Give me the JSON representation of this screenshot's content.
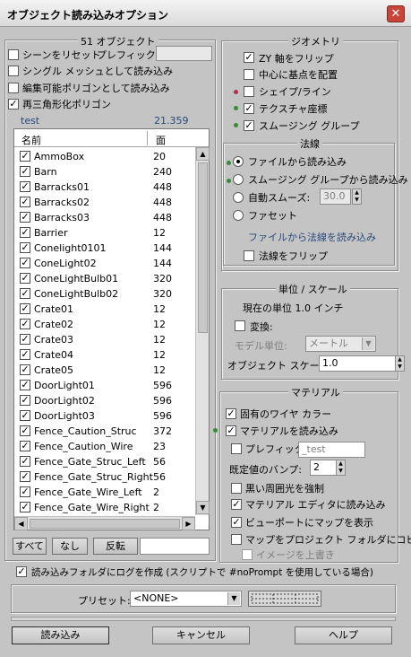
{
  "window": {
    "title": "オブジェクト読み込みオプション"
  },
  "left": {
    "object_count_label": "51 オブジェクト",
    "reset_scene": "シーンをリセット",
    "prefix_label": "プレフィックス:",
    "prefix_value": "",
    "single_mesh": "シングル メッシュとして読み込み",
    "editable_poly": "編集可能ポリゴンとして読み込み",
    "retriangulate": "再三角形化ポリゴン",
    "stat_name": "test",
    "stat_value": "21.359",
    "col_name": "名前",
    "col_faces": "面",
    "rows": [
      {
        "name": "AmmoBox",
        "faces": "20"
      },
      {
        "name": "Barn",
        "faces": "240"
      },
      {
        "name": "Barracks01",
        "faces": "448"
      },
      {
        "name": "Barracks02",
        "faces": "448"
      },
      {
        "name": "Barracks03",
        "faces": "448"
      },
      {
        "name": "Barrier",
        "faces": "12"
      },
      {
        "name": "Conelight0101",
        "faces": "144"
      },
      {
        "name": "ConeLight02",
        "faces": "144"
      },
      {
        "name": "ConeLightBulb01",
        "faces": "320"
      },
      {
        "name": "ConeLightBulb02",
        "faces": "320"
      },
      {
        "name": "Crate01",
        "faces": "12"
      },
      {
        "name": "Crate02",
        "faces": "12"
      },
      {
        "name": "Crate03",
        "faces": "12"
      },
      {
        "name": "Crate04",
        "faces": "12"
      },
      {
        "name": "Crate05",
        "faces": "12"
      },
      {
        "name": "DoorLight01",
        "faces": "596"
      },
      {
        "name": "DoorLight02",
        "faces": "596"
      },
      {
        "name": "DoorLight03",
        "faces": "596"
      },
      {
        "name": "Fence_Caution_Struc",
        "faces": "372"
      },
      {
        "name": "Fence_Caution_Wire",
        "faces": "23"
      },
      {
        "name": "Fence_Gate_Struc_Left",
        "faces": "56"
      },
      {
        "name": "Fence_Gate_Struc_Right",
        "faces": "56"
      },
      {
        "name": "Fence_Gate_Wire_Left",
        "faces": "2"
      },
      {
        "name": "Fence_Gate_Wire_Right",
        "faces": "2"
      }
    ],
    "btn_all": "すべて",
    "btn_none": "なし",
    "btn_invert": "反転"
  },
  "geometry": {
    "title": "ジオメトリ",
    "flip_zy": "ZY 軸をフリップ",
    "center_pivot": "中心に基点を配置",
    "shapes_lines": "シェイプ/ライン",
    "tex_coords": "テクスチャ座標",
    "smoothing_groups": "スムージング グループ"
  },
  "normals": {
    "title": "法線",
    "from_file": "ファイルから読み込み",
    "from_smoothing": "スムージング グループから読み込み",
    "auto_smooth": "自動スムーズ:",
    "auto_smooth_value": "30.0",
    "faceted": "ファセット",
    "note": "ファイルから法線を読み込み",
    "flip": "法線をフリップ"
  },
  "units": {
    "title": "単位 / スケール",
    "current": "現在の単位 1.0 インチ",
    "convert": "変換:",
    "model_units_label": "モデル単位:",
    "model_units_value": "メートル",
    "object_scale_label": "オブジェクト スケール:",
    "object_scale_value": "1.0"
  },
  "material": {
    "title": "マテリアル",
    "unique_wire": "固有のワイヤ カラー",
    "import_materials": "マテリアルを読み込み",
    "prefix": "プレフィックス",
    "prefix_value": "_test",
    "default_bump_label": "既定値のバンプ:",
    "default_bump_value": "2",
    "force_black_ambient": "黒い周囲光を強制",
    "import_into_editor": "マテリアル エディタに読み込み",
    "show_maps_viewport": "ビューポートにマップを表示",
    "copy_maps_project": "マップをプロジェクト フォルダにコピー",
    "overwrite_images": "イメージを上書き"
  },
  "log_option": "読み込みフォルダにログを作成 (スクリプトで #noPrompt を使用している場合)",
  "preset": {
    "label": "プリセット:",
    "value": "<NONE>"
  },
  "buttons": {
    "import": "読み込み",
    "cancel": "キャンセル",
    "help": "ヘルプ"
  },
  "colors": {
    "accent_link": "#2a4a7a",
    "dot_red": "#b0304a",
    "dot_green": "#3a8a3a",
    "close": "#c8443a"
  }
}
